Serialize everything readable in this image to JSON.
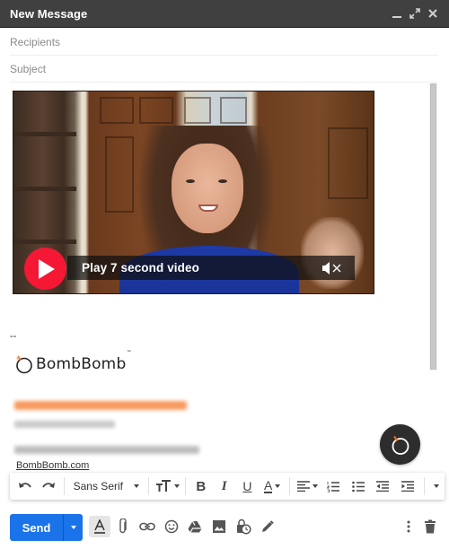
{
  "window": {
    "title": "New Message",
    "controls": [
      "minimize-icon",
      "expand-icon",
      "close-icon"
    ]
  },
  "fields": {
    "recipients_placeholder": "Recipients",
    "recipients_value": "",
    "subject_placeholder": "Subject",
    "subject_value": ""
  },
  "body": {
    "video": {
      "overlay_label": "Play 7 second video",
      "play_icon": "play-icon",
      "mute_icon": "muted-speaker-icon",
      "accent_color": "#f41835"
    },
    "signature": {
      "separator": "--",
      "logo_text": "BombBomb",
      "logo_tm": "™",
      "redacted_lines": 3,
      "link_text": "BombBomb.com"
    },
    "bombbomb_button_icon": "bombbomb-logo-icon"
  },
  "format_toolbar": {
    "undo_icon": "undo-icon",
    "redo_icon": "redo-icon",
    "font_family": "Sans Serif",
    "items": [
      "font-size-icon",
      "bold-icon",
      "italic-icon",
      "underline-icon",
      "text-color-icon",
      "align-icon",
      "numbered-list-icon",
      "bulleted-list-icon",
      "indent-less-icon",
      "indent-more-icon",
      "more-formatting-icon"
    ]
  },
  "bottom_toolbar": {
    "send_label": "Send",
    "accent_color": "#1a73e8",
    "icons": [
      "formatting-options-icon",
      "attach-file-icon",
      "insert-link-icon",
      "insert-emoji-icon",
      "google-drive-icon",
      "insert-photo-icon",
      "confidential-mode-icon",
      "signature-icon",
      "more-options-icon",
      "discard-draft-icon"
    ]
  }
}
